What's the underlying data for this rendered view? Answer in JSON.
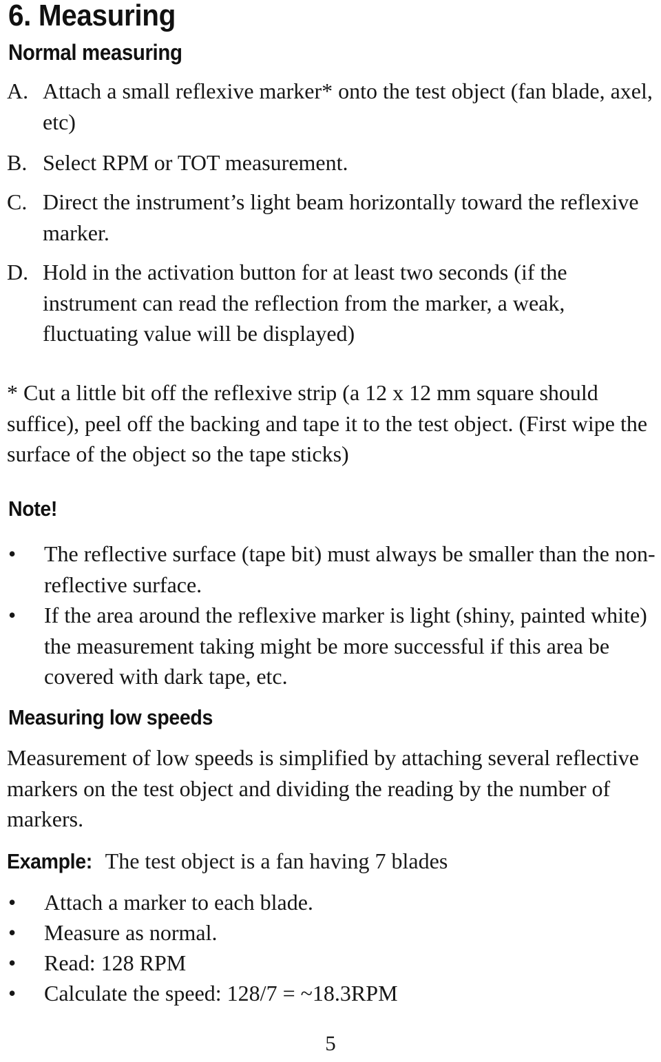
{
  "document": {
    "page_number": "5"
  },
  "headings": {
    "chapter": "6. Measuring",
    "normal_measuring": "Normal measuring",
    "note": "Note!",
    "low_speeds": "Measuring low speeds"
  },
  "steps": [
    {
      "marker": "A.",
      "text": "Attach a small reflexive marker* onto the test object (fan blade, axel, etc)"
    },
    {
      "marker": "B.",
      "text": "Select RPM or TOT measurement."
    },
    {
      "marker": "C.",
      "text": "Direct the instrument’s light beam horizontally toward the reflexive marker."
    },
    {
      "marker": "D.",
      "text": "Hold in the activation button for at least two seconds (if the instrument can read the reflection from the marker, a weak, fluctuating value will be displayed)"
    }
  ],
  "footnote": {
    "text": "* Cut a little bit off the reflexive strip (a 12 x 12 mm square should suffice), peel off the backing and tape it to the test object. (First wipe the surface of the object so the tape sticks)"
  },
  "note_bullets": [
    {
      "bullet": "•",
      "text": "The reflective surface (tape bit) must always be smaller than the non-reflective surface."
    },
    {
      "bullet": "•",
      "text": "If the area around the reflexive marker is light (shiny, painted white) the measurement taking might be more successful if this area be covered with dark tape, etc."
    }
  ],
  "low_speeds": {
    "paragraph": "Measurement of low speeds is simplified by attaching several reflective markers on the test object and dividing the reading by the number of markers."
  },
  "example": {
    "label": "Example:",
    "intro": "The test object is a fan having 7 blades",
    "bullets": [
      {
        "bullet": "•",
        "text": "Attach a marker to each blade."
      },
      {
        "bullet": "•",
        "text": "Measure as normal."
      },
      {
        "bullet": "•",
        "text": "Read: 128 RPM"
      },
      {
        "bullet": "•",
        "text": "Calculate the speed: 128/7 = ~18.3RPM"
      }
    ]
  }
}
